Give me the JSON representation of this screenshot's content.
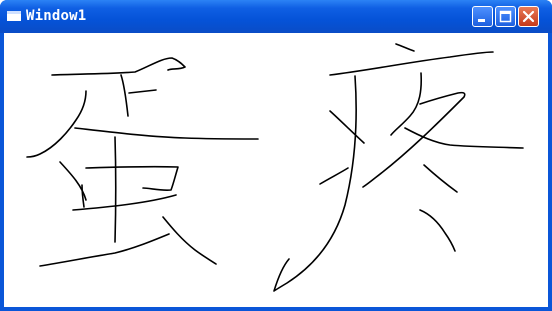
{
  "window": {
    "title": "Window1",
    "title_color": "#ffffff",
    "titlebar_color": "#0553d8",
    "client_background": "#ffffff",
    "ink_color": "#000000"
  },
  "controls": {
    "minimize_icon": "minimize-icon",
    "maximize_icon": "maximize-icon",
    "close_icon": "close-icon"
  }
}
